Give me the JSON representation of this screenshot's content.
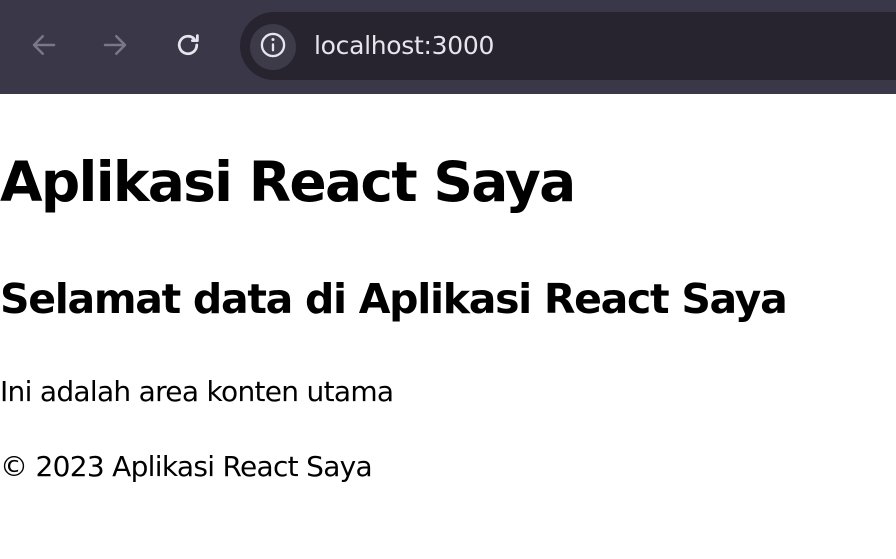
{
  "browser": {
    "url": "localhost:3000",
    "icons": {
      "back": "arrow-left-icon",
      "forward": "arrow-right-icon",
      "reload": "reload-icon",
      "site_info": "info-icon"
    },
    "colors": {
      "toolbar": "#3a3748",
      "omnibox": "#27242f",
      "url_text": "#e6e4ec"
    }
  },
  "page": {
    "title": "Aplikasi React Saya",
    "subtitle": "Selamat data di Aplikasi React Saya",
    "main_text": "Ini adalah area konten utama",
    "footer_text": "© 2023 Aplikasi React Saya"
  }
}
